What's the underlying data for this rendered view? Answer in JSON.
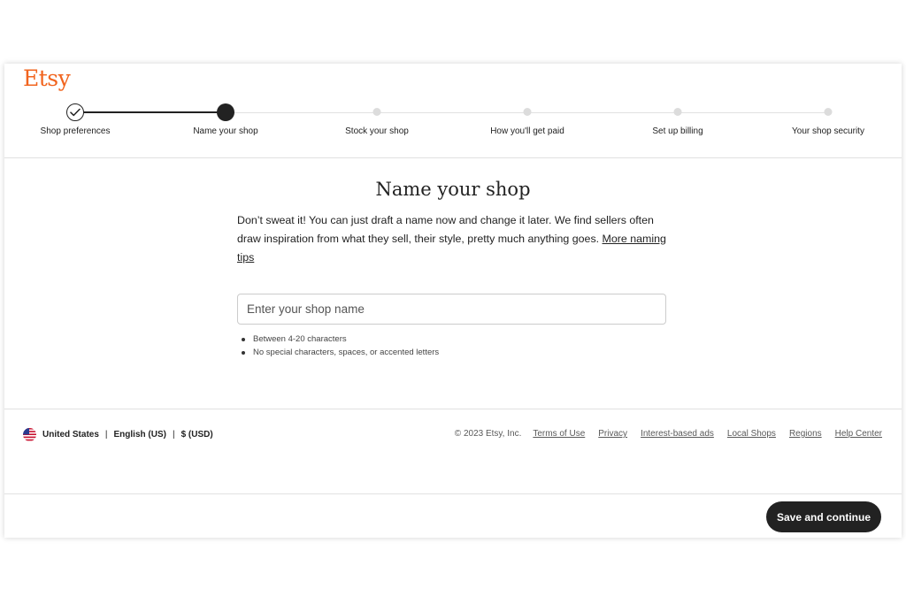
{
  "brand": {
    "logo_text": "Etsy",
    "accent_color": "#f1641e"
  },
  "stepper": {
    "steps": [
      {
        "label": "Shop preferences",
        "state": "completed",
        "icon": "checkmark-icon"
      },
      {
        "label": "Name your shop",
        "state": "current"
      },
      {
        "label": "Stock your shop",
        "state": "upcoming"
      },
      {
        "label": "How you'll get paid",
        "state": "upcoming"
      },
      {
        "label": "Set up billing",
        "state": "upcoming"
      },
      {
        "label": "Your shop security",
        "state": "upcoming"
      }
    ]
  },
  "main": {
    "title": "Name your shop",
    "intro": "Don’t sweat it! You can just draft a name now and change it later. We find sellers often draw inspiration from what they sell, their style, pretty much anything goes.",
    "tips_link": "More naming tips",
    "shop_name_input": {
      "value": "",
      "placeholder": "Enter your shop name"
    },
    "rules": [
      "Between 4-20 characters",
      "No special characters, spaces, or accented letters"
    ]
  },
  "footer": {
    "flag_icon": "us-flag-icon",
    "region": "United States",
    "language": "English (US)",
    "currency": "$ (USD)",
    "copyright": "© 2023 Etsy, Inc.",
    "links": [
      "Terms of Use",
      "Privacy",
      "Interest-based ads",
      "Local Shops",
      "Regions",
      "Help Center"
    ]
  },
  "actions": {
    "save_label": "Save and continue",
    "button_color": "#222222"
  }
}
